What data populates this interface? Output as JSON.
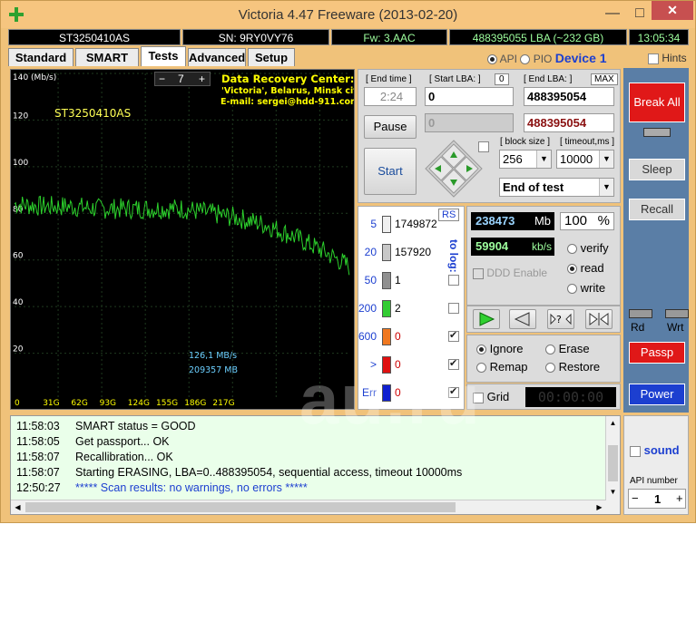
{
  "window": {
    "title": "Victoria 4.47  Freeware (2013-02-20)",
    "min": "—",
    "max": "□",
    "close": "✕"
  },
  "info": {
    "model": "ST3250410AS",
    "serial": "SN: 9RY0VY76",
    "fw": "Fw: 3.AAC",
    "lba": "488395055 LBA (~232 GB)",
    "clock": "13:05:34"
  },
  "tabs": [
    "Standard",
    "SMART",
    "Tests",
    "Advanced",
    "Setup"
  ],
  "topright": {
    "api": "API",
    "pio": "PIO",
    "device": "Device 1",
    "hints": "Hints"
  },
  "graph": {
    "y_unit": "140 (Mb/s)",
    "y_ticks": [
      "120",
      "100",
      "80",
      "60",
      "40",
      "20"
    ],
    "x_ticks": [
      "0",
      "31G",
      "62G",
      "93G",
      "124G",
      "155G",
      "186G",
      "217G"
    ],
    "zoom": "7",
    "zoom_minus": "−",
    "zoom_plus": "+",
    "drive_label": "ST3250410AS",
    "center_title": "Data Recovery Center:",
    "center_line2": "'Victoria', Belarus, Minsk city",
    "center_line3": "E-mail: sergei@hdd-911.com",
    "speed_text": "126,1 MB/s",
    "size_text": "209357 MB"
  },
  "chart_data": {
    "type": "line",
    "xlabel": "",
    "ylabel": "",
    "y_unit": "Mb/s",
    "ylim": [
      0,
      140
    ],
    "xlim": [
      0,
      240
    ],
    "x_ticks": [
      "0",
      "31G",
      "62G",
      "93G",
      "124G",
      "155G",
      "186G",
      "217G"
    ],
    "series": [
      {
        "name": "",
        "values": [
          [
            0,
            84
          ],
          [
            20,
            83
          ],
          [
            40,
            83
          ],
          [
            60,
            82
          ],
          [
            80,
            82
          ],
          [
            100,
            82
          ],
          [
            120,
            82
          ],
          [
            140,
            80
          ],
          [
            160,
            78
          ],
          [
            180,
            75
          ],
          [
            200,
            70
          ],
          [
            220,
            64
          ],
          [
            240,
            57
          ]
        ]
      }
    ]
  },
  "test": {
    "end_time_label": "[ End time ]",
    "end_time": "2:24",
    "start_lba_label": "[ Start LBA: ]",
    "start_lba_zero": "0",
    "start_lba": "0",
    "end_lba_label": "[ End LBA: ]",
    "end_lba_max": "MAX",
    "end_lba": "488395054",
    "cur_lba_left": "0",
    "cur_lba": "488395054",
    "pause": "Pause",
    "start": "Start",
    "block_size_label": "[ block size ]",
    "block_size": "256",
    "timeout_label": "[ timeout,ms ]",
    "timeout": "10000",
    "end_action": "End of test"
  },
  "blocks": {
    "rs": "RS",
    "to_log": "to log:",
    "rows": [
      {
        "label": "5",
        "count": "1749872",
        "color": "#f0f0f0"
      },
      {
        "label": "20",
        "count": "157920",
        "color": "#c8c8c8"
      },
      {
        "label": "50",
        "count": "1",
        "color": "#909090"
      },
      {
        "label": "200",
        "count": "2",
        "color": "#33cc33"
      },
      {
        "label": "600",
        "count": "0",
        "color": "#f07820"
      },
      {
        "label": ">",
        "count": "0",
        "color": "#e01010"
      },
      {
        "label": "Err",
        "count": "0",
        "color": "#1020d0"
      }
    ]
  },
  "stats": {
    "mb": "238473",
    "mb_unit": "Mb",
    "percent": "100",
    "percent_unit": "%",
    "speed": "59904",
    "speed_unit": "kb/s",
    "ddd": "DDD Enable",
    "verify": "verify",
    "read": "read",
    "write": "write"
  },
  "actions": {
    "ignore": "Ignore",
    "erase": "Erase",
    "remap": "Remap",
    "restore": "Restore",
    "grid": "Grid",
    "timer": "00:00:00"
  },
  "sidebar": {
    "break": "Break All",
    "sleep": "Sleep",
    "recall": "Recall",
    "rd": "Rd",
    "wrt": "Wrt",
    "passp": "Passp",
    "power": "Power",
    "sound": "sound",
    "api_number_label": "API number",
    "api_number": "1",
    "api_minus": "−",
    "api_plus": "+"
  },
  "log": [
    {
      "time": "11:58:03",
      "text": "SMART status = GOOD",
      "blue": false
    },
    {
      "time": "11:58:05",
      "text": "Get passport... OK",
      "blue": false
    },
    {
      "time": "11:58:07",
      "text": "Recallibration... OK",
      "blue": false
    },
    {
      "time": "11:58:07",
      "text": "Starting ERASING, LBA=0..488395054, sequential access, timeout 10000ms",
      "blue": false
    },
    {
      "time": "12:50:27",
      "text": "***** Scan results: no warnings, no errors *****",
      "blue": true
    }
  ],
  "watermark": "au.ru"
}
